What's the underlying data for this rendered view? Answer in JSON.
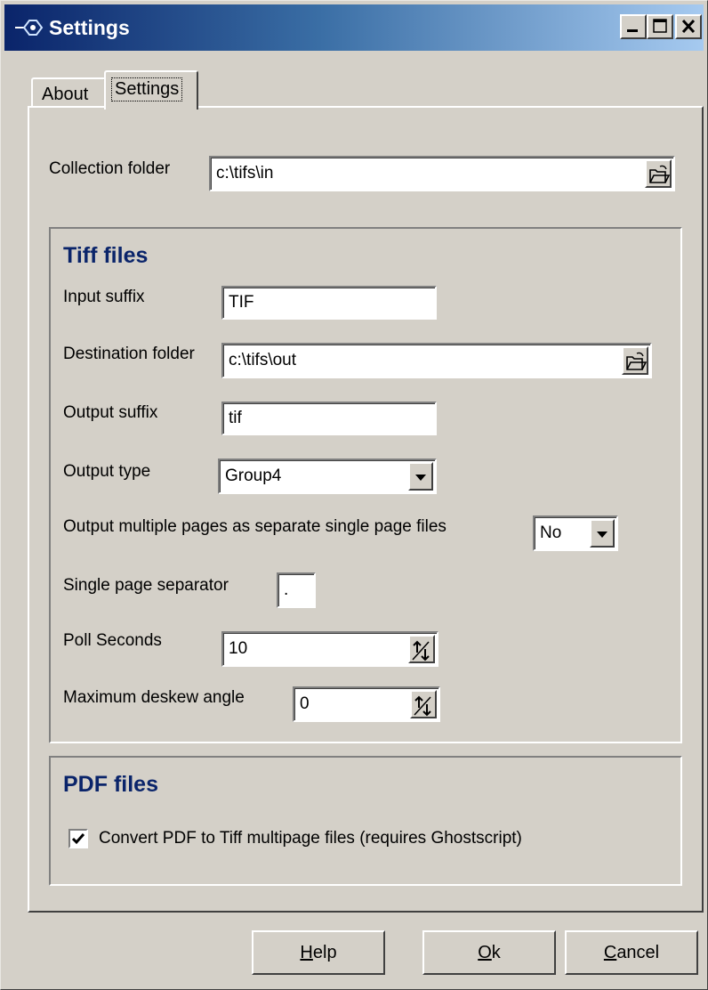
{
  "window": {
    "title": "Settings"
  },
  "tabs": [
    {
      "label": "About"
    },
    {
      "label": "Settings"
    }
  ],
  "collection": {
    "label": "Collection folder",
    "value": "c:\\tifs\\in"
  },
  "tiff": {
    "title": "Tiff files",
    "input_suffix": {
      "label": "Input suffix",
      "value": "TIF"
    },
    "destination": {
      "label": "Destination folder",
      "value": "c:\\tifs\\out"
    },
    "output_suffix": {
      "label": "Output suffix",
      "value": "tif"
    },
    "output_type": {
      "label": "Output type",
      "value": "Group4"
    },
    "multiple_pages": {
      "label": "Output multiple pages as separate single page files",
      "value": "No"
    },
    "separator": {
      "label": "Single page separator",
      "value": "."
    },
    "poll": {
      "label": "Poll Seconds",
      "value": "10"
    },
    "deskew": {
      "label": "Maximum deskew angle",
      "value": "0"
    }
  },
  "pdf": {
    "title": "PDF files",
    "convert": {
      "label": "Convert PDF to Tiff multipage files (requires Ghostscript)",
      "checked": true
    }
  },
  "buttons": {
    "help": {
      "accel": "H",
      "rest": "elp"
    },
    "ok": {
      "accel": "O",
      "rest": "k"
    },
    "cancel": {
      "accel": "C",
      "rest": "ancel"
    }
  }
}
